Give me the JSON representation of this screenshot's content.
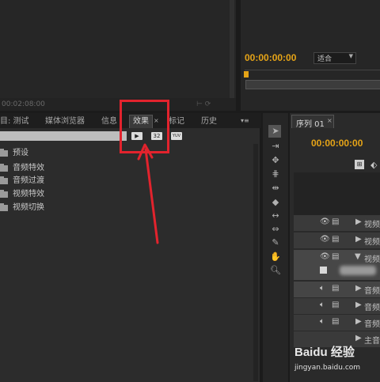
{
  "source_monitor": {
    "timecode": "00:02:08:00"
  },
  "program_monitor": {
    "timecode": "00:00:00:00",
    "zoom": "适合"
  },
  "project_panel": {
    "tabs": [
      {
        "label": "目: 测试"
      },
      {
        "label": "媒体浏览器"
      },
      {
        "label": "信息"
      },
      {
        "label": "效果"
      },
      {
        "label": "标记"
      },
      {
        "label": "历史"
      }
    ],
    "icon_buttons": [
      "32",
      "YUV"
    ],
    "tree": [
      {
        "label": "预设"
      },
      {
        "label": "音频特效"
      },
      {
        "label": "音频过渡"
      },
      {
        "label": "视频特效"
      },
      {
        "label": "视频切换"
      }
    ]
  },
  "timeline": {
    "tab_label": "序列 01",
    "timecode": "00:00:00:00",
    "tracks": [
      {
        "label": "视频"
      },
      {
        "label": "视频"
      },
      {
        "label": "视频"
      },
      {
        "label": "音频"
      },
      {
        "label": "音频"
      },
      {
        "label": "音频"
      },
      {
        "label": "主音"
      }
    ]
  },
  "watermark": {
    "text": "Baidu 经验",
    "url": "jingyan.baidu.com"
  },
  "annotation_color": "#e2232d"
}
